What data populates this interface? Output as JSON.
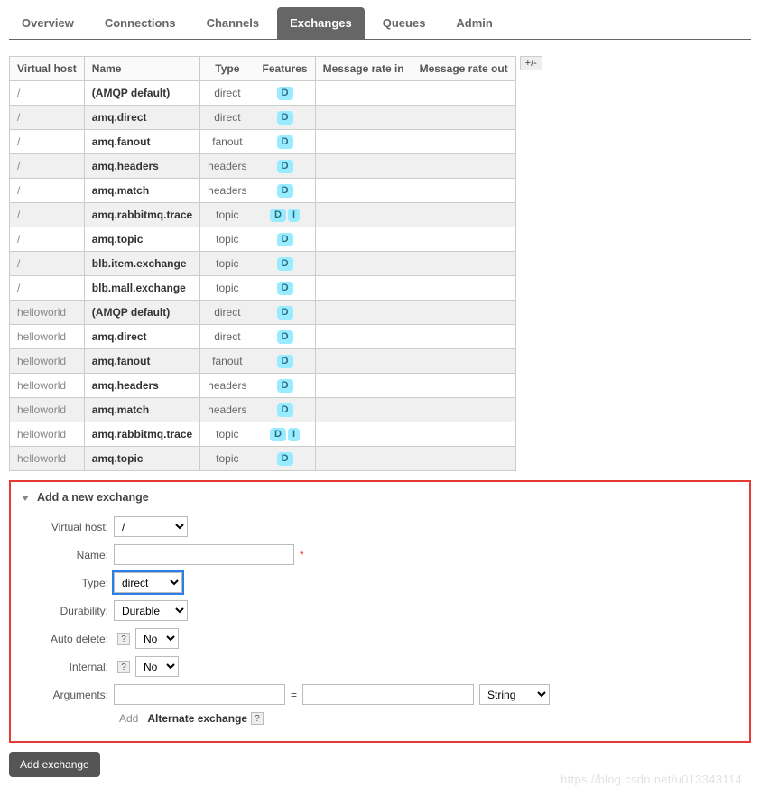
{
  "tabs": {
    "overview": "Overview",
    "connections": "Connections",
    "channels": "Channels",
    "exchanges": "Exchanges",
    "queues": "Queues",
    "admin": "Admin",
    "active": "exchanges"
  },
  "table": {
    "headers": {
      "vhost": "Virtual host",
      "name": "Name",
      "type": "Type",
      "features": "Features",
      "rate_in": "Message rate in",
      "rate_out": "Message rate out"
    },
    "rows": [
      {
        "vhost": "/",
        "name": "(AMQP default)",
        "type": "direct",
        "features": [
          "D"
        ]
      },
      {
        "vhost": "/",
        "name": "amq.direct",
        "type": "direct",
        "features": [
          "D"
        ]
      },
      {
        "vhost": "/",
        "name": "amq.fanout",
        "type": "fanout",
        "features": [
          "D"
        ]
      },
      {
        "vhost": "/",
        "name": "amq.headers",
        "type": "headers",
        "features": [
          "D"
        ]
      },
      {
        "vhost": "/",
        "name": "amq.match",
        "type": "headers",
        "features": [
          "D"
        ]
      },
      {
        "vhost": "/",
        "name": "amq.rabbitmq.trace",
        "type": "topic",
        "features": [
          "D",
          "I"
        ]
      },
      {
        "vhost": "/",
        "name": "amq.topic",
        "type": "topic",
        "features": [
          "D"
        ]
      },
      {
        "vhost": "/",
        "name": "blb.item.exchange",
        "type": "topic",
        "features": [
          "D"
        ]
      },
      {
        "vhost": "/",
        "name": "blb.mall.exchange",
        "type": "topic",
        "features": [
          "D"
        ]
      },
      {
        "vhost": "helloworld",
        "name": "(AMQP default)",
        "type": "direct",
        "features": [
          "D"
        ]
      },
      {
        "vhost": "helloworld",
        "name": "amq.direct",
        "type": "direct",
        "features": [
          "D"
        ]
      },
      {
        "vhost": "helloworld",
        "name": "amq.fanout",
        "type": "fanout",
        "features": [
          "D"
        ]
      },
      {
        "vhost": "helloworld",
        "name": "amq.headers",
        "type": "headers",
        "features": [
          "D"
        ]
      },
      {
        "vhost": "helloworld",
        "name": "amq.match",
        "type": "headers",
        "features": [
          "D"
        ]
      },
      {
        "vhost": "helloworld",
        "name": "amq.rabbitmq.trace",
        "type": "topic",
        "features": [
          "D",
          "I"
        ]
      },
      {
        "vhost": "helloworld",
        "name": "amq.topic",
        "type": "topic",
        "features": [
          "D"
        ]
      }
    ],
    "pm_button": "+/-"
  },
  "form": {
    "title": "Add a new exchange",
    "labels": {
      "vhost": "Virtual host:",
      "name": "Name:",
      "type": "Type:",
      "durability": "Durability:",
      "auto_delete": "Auto delete:",
      "internal": "Internal:",
      "arguments": "Arguments:"
    },
    "values": {
      "vhost": "/",
      "name": "",
      "type": "direct",
      "durability": "Durable",
      "auto_delete": "No",
      "internal": "No",
      "arg_key": "",
      "arg_val": "",
      "arg_type": "String"
    },
    "add_label": "Add",
    "ae_label": "Alternate exchange",
    "required_mark": "*",
    "help_mark": "?",
    "eq": "="
  },
  "add_exchange_button": "Add exchange",
  "watermark": "https://blog.csdn.net/u013343114"
}
